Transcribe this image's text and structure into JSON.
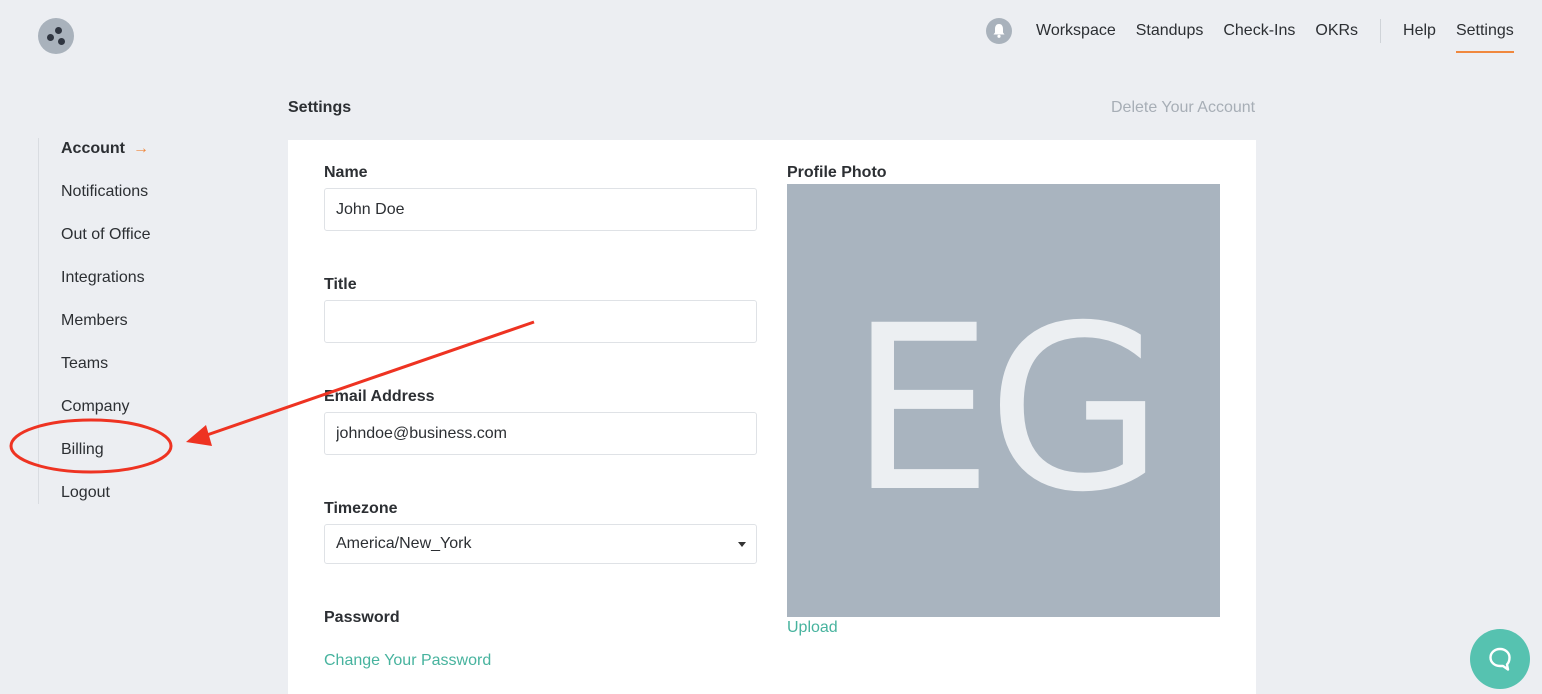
{
  "topnav": {
    "items": [
      {
        "label": "Workspace"
      },
      {
        "label": "Standups"
      },
      {
        "label": "Check-Ins"
      },
      {
        "label": "OKRs"
      }
    ],
    "help": "Help",
    "settings": "Settings"
  },
  "sidebar": {
    "items": [
      {
        "label": "Account",
        "active": true
      },
      {
        "label": "Notifications"
      },
      {
        "label": "Out of Office"
      },
      {
        "label": "Integrations"
      },
      {
        "label": "Members"
      },
      {
        "label": "Teams"
      },
      {
        "label": "Company"
      },
      {
        "label": "Billing"
      },
      {
        "label": "Logout"
      }
    ],
    "active_arrow": "→"
  },
  "page": {
    "title": "Settings",
    "delete_account": "Delete Your Account"
  },
  "form": {
    "name_label": "Name",
    "name_value": "John Doe",
    "title_label": "Title",
    "title_value": "",
    "email_label": "Email Address",
    "email_value": "johndoe@business.com",
    "timezone_label": "Timezone",
    "timezone_value": "America/New_York",
    "password_label": "Password",
    "change_password": "Change Your Password"
  },
  "profile": {
    "label": "Profile Photo",
    "initials": "EG",
    "upload": "Upload"
  },
  "colors": {
    "accent_orange": "#f0883e",
    "link_teal": "#47b39e",
    "annotation_red": "#ee3322",
    "help_widget": "#56c2b0"
  },
  "icons": {
    "logo": "dots-logo-icon",
    "bell": "bell-icon",
    "help": "chat-bubble-icon"
  }
}
